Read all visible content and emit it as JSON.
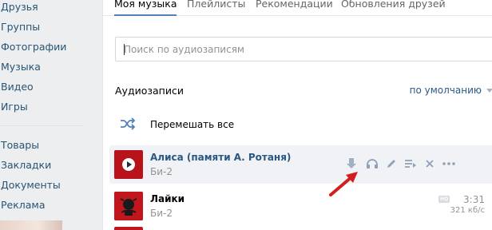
{
  "sidebar": {
    "items_top": [
      "Друзья",
      "Группы",
      "Фотографии",
      "Музыка",
      "Видео",
      "Игры"
    ],
    "items_bottom": [
      "Товары",
      "Закладки",
      "Документы",
      "Реклама"
    ]
  },
  "tabs": [
    {
      "label": "Моя музыка",
      "active": true
    },
    {
      "label": "Плейлисты",
      "active": false
    },
    {
      "label": "Рекомендации",
      "active": false
    },
    {
      "label": "Обновления друзей",
      "active": false
    }
  ],
  "search": {
    "placeholder": "Поиск по аудиозаписям",
    "value": ""
  },
  "section": {
    "title": "Аудиозаписи",
    "sort_label": "по умолчанию"
  },
  "shuffle": {
    "label": "Перемешать все",
    "icon": "shuffle-icon"
  },
  "tracks": [
    {
      "title": "Алиса (памяти А. Ротаня)",
      "artist": "Би-2",
      "playing": true,
      "actions": [
        "download-icon",
        "headphones-icon",
        "edit-icon",
        "add-to-playlist-icon",
        "remove-icon",
        "more-icon"
      ]
    },
    {
      "title": "Лайки",
      "artist": "Би-2",
      "hq_badge": "HQ",
      "duration": "3:31",
      "bitrate": "321 кб/с"
    }
  ],
  "colors": {
    "accent": "#5181b8",
    "link": "#2a5885",
    "arrow": "#d11f1f",
    "cover": "#b8121a"
  }
}
